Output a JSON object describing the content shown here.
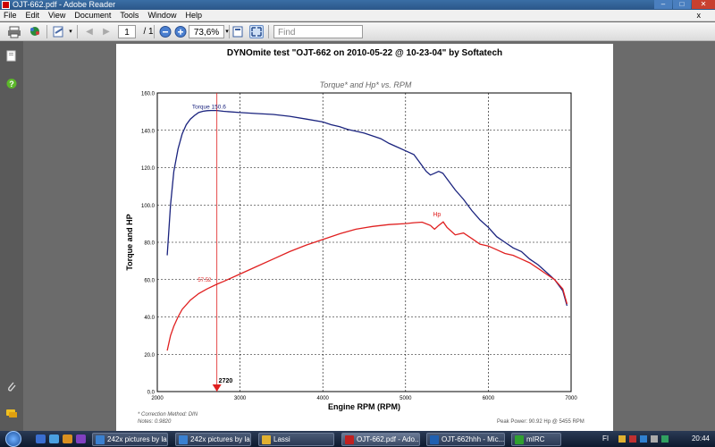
{
  "window": {
    "title": "OJT-662.pdf - Adobe Reader",
    "buttons": [
      "–",
      "□",
      "✕"
    ]
  },
  "menu": {
    "items": [
      "File",
      "Edit",
      "View",
      "Document",
      "Tools",
      "Window",
      "Help"
    ],
    "close": "x"
  },
  "toolbar": {
    "page_current": "1",
    "page_total": "/ 1",
    "zoom": "73,6%",
    "find_placeholder": "Find"
  },
  "document": {
    "page_title": "DYNOmite test \"OJT-662 on 2010-05-22 @ 10-23-04\" by Softatech",
    "footnote_method": "* Correction Method: DIN",
    "footnote_factor": "Notes: 0.9820",
    "peak_power": "Peak Power: 90.92 Hp @ 5455 RPM"
  },
  "chart_data": {
    "type": "line",
    "title": "Torque* and Hp* vs. RPM",
    "xlabel": "Engine RPM (RPM)",
    "ylabel": "Torque and HP",
    "xlim": [
      2000,
      7000
    ],
    "ylim": [
      0,
      160
    ],
    "x_ticks": [
      "2000",
      "3000",
      "4000",
      "5000",
      "6000",
      "7000"
    ],
    "y_ticks": [
      "0.0",
      "20.0",
      "40.0",
      "60.0",
      "80.0",
      "100.0",
      "120.0",
      "140.0",
      "160.0"
    ],
    "grid": true,
    "cursor": {
      "x": 2720,
      "label": "2720"
    },
    "series": [
      {
        "name": "Torque",
        "color": "#1a237e",
        "label": "Torque  150.6",
        "x": [
          2120,
          2160,
          2200,
          2250,
          2300,
          2350,
          2400,
          2450,
          2500,
          2550,
          2600,
          2650,
          2700,
          2720,
          2800,
          3000,
          3200,
          3400,
          3600,
          3800,
          4000,
          4100,
          4200,
          4300,
          4400,
          4500,
          4600,
          4700,
          4800,
          4900,
          5000,
          5100,
          5150,
          5200,
          5250,
          5300,
          5350,
          5400,
          5450,
          5500,
          5600,
          5700,
          5800,
          5900,
          6000,
          6100,
          6200,
          6300,
          6400,
          6500,
          6600,
          6700,
          6800,
          6900,
          6950
        ],
        "values": [
          73,
          100,
          118,
          130,
          138,
          143,
          146,
          148,
          149.5,
          150.2,
          150.5,
          150.6,
          150.6,
          150.6,
          150.2,
          149.5,
          149,
          148.5,
          147.5,
          146,
          144.5,
          143,
          142,
          140.5,
          139.5,
          138.5,
          137,
          135.5,
          133,
          131,
          129,
          127,
          124,
          121,
          118,
          116,
          117,
          118,
          117,
          114,
          108,
          103,
          97,
          92,
          88,
          83,
          80,
          77,
          75,
          71,
          68,
          64,
          60,
          54,
          46
        ]
      },
      {
        "name": "Hp",
        "color": "#e02020",
        "label": "Hp",
        "x": [
          2120,
          2160,
          2200,
          2250,
          2300,
          2400,
          2500,
          2600,
          2720,
          2800,
          3000,
          3200,
          3400,
          3600,
          3800,
          4000,
          4200,
          4400,
          4600,
          4800,
          5000,
          5100,
          5200,
          5300,
          5350,
          5400,
          5455,
          5500,
          5600,
          5700,
          5800,
          5900,
          6000,
          6100,
          6200,
          6300,
          6400,
          6500,
          6600,
          6700,
          6800,
          6900,
          6950
        ],
        "values": [
          22,
          30,
          35,
          40,
          44,
          49,
          52.5,
          55,
          57.52,
          59,
          63,
          67,
          71,
          75,
          78.5,
          81.5,
          84.5,
          87,
          88.5,
          89.5,
          90,
          90.5,
          90.8,
          89,
          87,
          89,
          90.92,
          88,
          84,
          85,
          82,
          79,
          78,
          76,
          74,
          73,
          71,
          69,
          66,
          63,
          60,
          55,
          47
        ]
      }
    ],
    "annotations": [
      "Torque  150.6",
      "Hp",
      "57.52",
      "2720"
    ]
  },
  "taskbar": {
    "tasks": [
      "242x pictures by la...",
      "242x pictures by la...",
      "Lassi",
      "OJT-662.pdf - Ado...",
      "OJT-662hhh - Mic...",
      "mIRC"
    ],
    "lang": "FI",
    "clock": "20:44"
  }
}
